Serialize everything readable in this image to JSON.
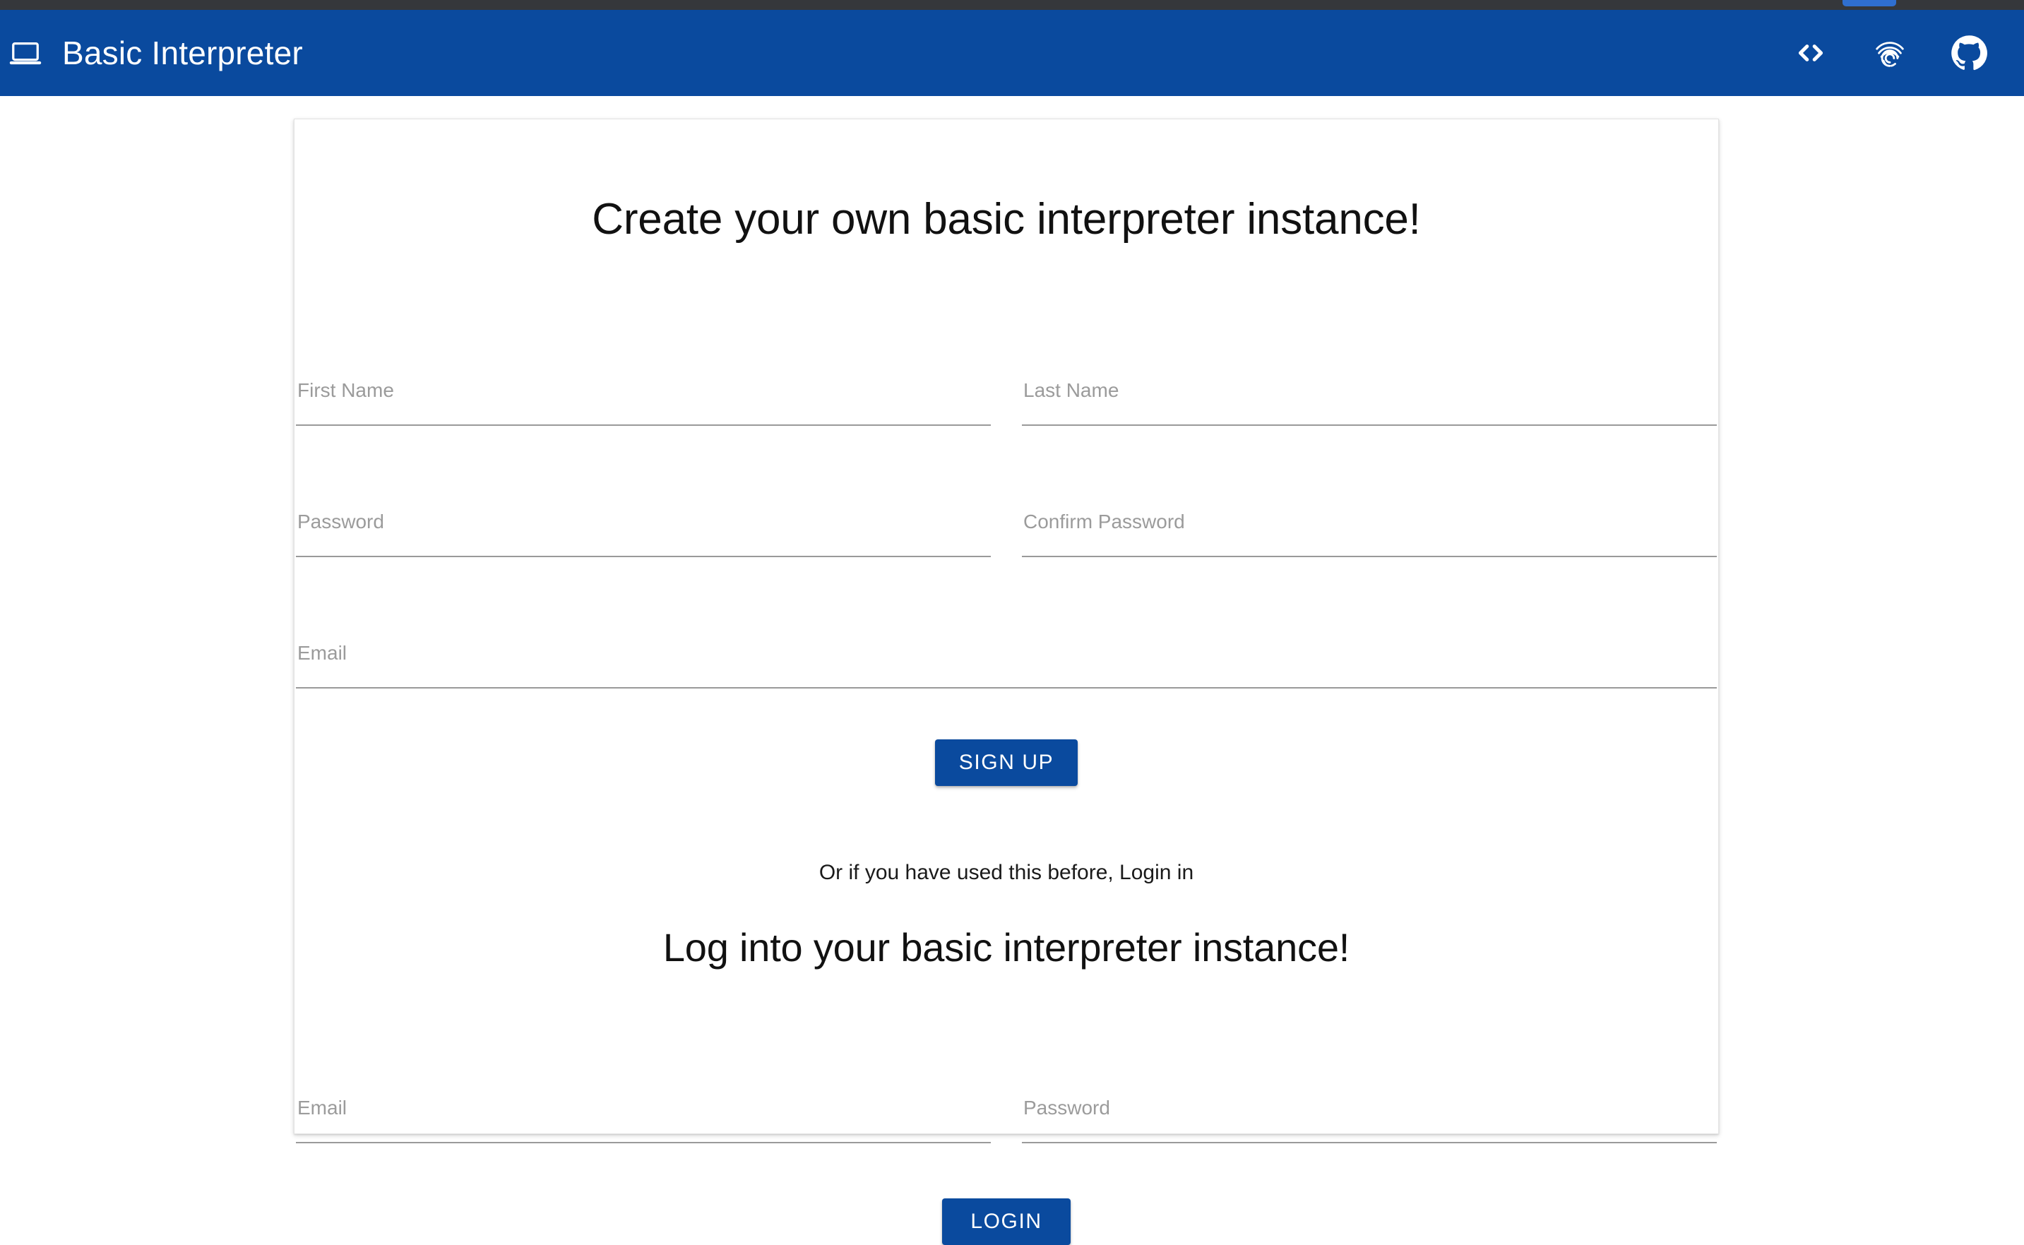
{
  "appbar": {
    "title": "Basic Interpreter",
    "logo_icon": "laptop-icon",
    "actions": [
      {
        "name": "code-brackets-icon",
        "label": "<>"
      },
      {
        "name": "fingerprint-icon",
        "label": "Fingerprint"
      },
      {
        "name": "github-icon",
        "label": "GitHub"
      }
    ],
    "background_color": "#0a4a9e",
    "text_color": "#ffffff"
  },
  "signup": {
    "heading": "Create your own basic interpreter instance!",
    "fields": {
      "first_name": {
        "label": "First Name",
        "value": "",
        "placeholder": "First Name"
      },
      "last_name": {
        "label": "Last Name",
        "value": "",
        "placeholder": "Last Name"
      },
      "password": {
        "label": "Password",
        "value": "",
        "placeholder": "Password"
      },
      "confirm_password": {
        "label": "Confirm Password",
        "value": "",
        "placeholder": "Confirm Password"
      },
      "email": {
        "label": "Email",
        "value": "",
        "placeholder": "Email"
      }
    },
    "submit_label": "SIGN UP"
  },
  "divider_text": "Or if you have used this before, Login in",
  "login": {
    "heading": "Log into your basic interpreter instance!",
    "fields": {
      "email": {
        "label": "Email",
        "value": "",
        "placeholder": "Email"
      },
      "password": {
        "label": "Password",
        "value": "",
        "placeholder": "Password"
      }
    },
    "submit_label": "LOGIN"
  },
  "theme": {
    "primary": "#0a4a9e",
    "card_background": "#ffffff",
    "page_background": "#ffffff",
    "label_color": "#9b9b9b",
    "underline_color": "#9a9a9a",
    "chrome_color": "#35373b"
  }
}
